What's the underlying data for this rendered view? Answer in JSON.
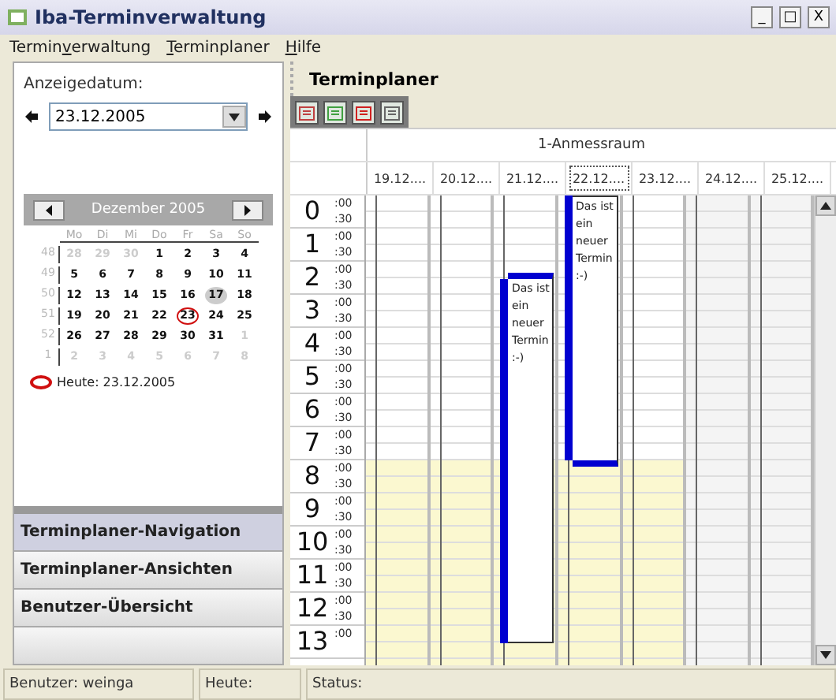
{
  "window": {
    "title": "Iba-Terminverwaltung",
    "controls": [
      "_",
      "□",
      "X"
    ]
  },
  "menu": [
    {
      "parts": [
        {
          "text": "Termin",
          "underlined": false
        },
        {
          "text": "v",
          "underlined": true
        },
        {
          "text": "erwaltung",
          "underlined": false
        }
      ]
    },
    {
      "parts": [
        {
          "text": "T",
          "underlined": true
        },
        {
          "text": "erminplaner",
          "underlined": false
        }
      ]
    },
    {
      "parts": [
        {
          "text": "H",
          "underlined": true
        },
        {
          "text": "ilfe",
          "underlined": false
        }
      ]
    }
  ],
  "date_selector": {
    "label": "Anzeigedatum:",
    "value": "23.12.2005"
  },
  "calendar": {
    "month": "Dezember 2005",
    "weekdays": [
      "Mo",
      "Di",
      "Mi",
      "Do",
      "Fr",
      "Sa",
      "So"
    ],
    "weeks": [
      {
        "number": "48",
        "days": [
          {
            "label": "28",
            "other_month": true,
            "today": false,
            "hover": false
          },
          {
            "label": "29",
            "other_month": true,
            "today": false,
            "hover": false
          },
          {
            "label": "30",
            "other_month": true,
            "today": false,
            "hover": false
          },
          {
            "label": "1",
            "other_month": false,
            "today": false,
            "hover": false
          },
          {
            "label": "2",
            "other_month": false,
            "today": false,
            "hover": false
          },
          {
            "label": "3",
            "other_month": false,
            "today": false,
            "hover": false
          },
          {
            "label": "4",
            "other_month": false,
            "today": false,
            "hover": false
          }
        ]
      },
      {
        "number": "49",
        "days": [
          {
            "label": "5",
            "other_month": false,
            "today": false,
            "hover": false
          },
          {
            "label": "6",
            "other_month": false,
            "today": false,
            "hover": false
          },
          {
            "label": "7",
            "other_month": false,
            "today": false,
            "hover": false
          },
          {
            "label": "8",
            "other_month": false,
            "today": false,
            "hover": false
          },
          {
            "label": "9",
            "other_month": false,
            "today": false,
            "hover": false
          },
          {
            "label": "10",
            "other_month": false,
            "today": false,
            "hover": false
          },
          {
            "label": "11",
            "other_month": false,
            "today": false,
            "hover": false
          }
        ]
      },
      {
        "number": "50",
        "days": [
          {
            "label": "12",
            "other_month": false,
            "today": false,
            "hover": false
          },
          {
            "label": "13",
            "other_month": false,
            "today": false,
            "hover": false
          },
          {
            "label": "14",
            "other_month": false,
            "today": false,
            "hover": false
          },
          {
            "label": "15",
            "other_month": false,
            "today": false,
            "hover": false
          },
          {
            "label": "16",
            "other_month": false,
            "today": false,
            "hover": false
          },
          {
            "label": "17",
            "other_month": false,
            "today": false,
            "hover": true
          },
          {
            "label": "18",
            "other_month": false,
            "today": false,
            "hover": false
          }
        ]
      },
      {
        "number": "51",
        "days": [
          {
            "label": "19",
            "other_month": false,
            "today": false,
            "hover": false
          },
          {
            "label": "20",
            "other_month": false,
            "today": false,
            "hover": false
          },
          {
            "label": "21",
            "other_month": false,
            "today": false,
            "hover": false
          },
          {
            "label": "22",
            "other_month": false,
            "today": false,
            "hover": false
          },
          {
            "label": "23",
            "other_month": false,
            "today": true,
            "hover": false
          },
          {
            "label": "24",
            "other_month": false,
            "today": false,
            "hover": false
          },
          {
            "label": "25",
            "other_month": false,
            "today": false,
            "hover": false
          }
        ]
      },
      {
        "number": "52",
        "days": [
          {
            "label": "26",
            "other_month": false,
            "today": false,
            "hover": false
          },
          {
            "label": "27",
            "other_month": false,
            "today": false,
            "hover": false
          },
          {
            "label": "28",
            "other_month": false,
            "today": false,
            "hover": false
          },
          {
            "label": "29",
            "other_month": false,
            "today": false,
            "hover": false
          },
          {
            "label": "30",
            "other_month": false,
            "today": false,
            "hover": false
          },
          {
            "label": "31",
            "other_month": false,
            "today": false,
            "hover": false
          },
          {
            "label": "1",
            "other_month": true,
            "today": false,
            "hover": false
          }
        ]
      },
      {
        "number": "1",
        "days": [
          {
            "label": "2",
            "other_month": true,
            "today": false,
            "hover": false
          },
          {
            "label": "3",
            "other_month": true,
            "today": false,
            "hover": false
          },
          {
            "label": "4",
            "other_month": true,
            "today": false,
            "hover": false
          },
          {
            "label": "5",
            "other_month": true,
            "today": false,
            "hover": false
          },
          {
            "label": "6",
            "other_month": true,
            "today": false,
            "hover": false
          },
          {
            "label": "7",
            "other_month": true,
            "today": false,
            "hover": false
          },
          {
            "label": "8",
            "other_month": true,
            "today": false,
            "hover": false
          }
        ]
      }
    ],
    "today_label": "Heute: 23.12.2005"
  },
  "nav_sections": [
    {
      "label": "Terminplaner-Navigation",
      "selected": true
    },
    {
      "label": "Terminplaner-Ansichten",
      "selected": false
    },
    {
      "label": "Benutzer-Übersicht",
      "selected": false
    }
  ],
  "planner": {
    "title": "Terminplaner",
    "room": "1-Anmessraum",
    "hours": [
      {
        "hour": "0",
        "marks": [
          ":00",
          ":30"
        ]
      },
      {
        "hour": "1",
        "marks": [
          ":00",
          ":30"
        ]
      },
      {
        "hour": "2",
        "marks": [
          ":00",
          ":30"
        ]
      },
      {
        "hour": "3",
        "marks": [
          ":00",
          ":30"
        ]
      },
      {
        "hour": "4",
        "marks": [
          ":00",
          ":30"
        ]
      },
      {
        "hour": "5",
        "marks": [
          ":00",
          ":30"
        ]
      },
      {
        "hour": "6",
        "marks": [
          ":00",
          ":30"
        ]
      },
      {
        "hour": "7",
        "marks": [
          ":00",
          ":30"
        ]
      },
      {
        "hour": "8",
        "marks": [
          ":00",
          ":30"
        ]
      },
      {
        "hour": "9",
        "marks": [
          ":00",
          ":30"
        ]
      },
      {
        "hour": "10",
        "marks": [
          ":00",
          ":30"
        ]
      },
      {
        "hour": "11",
        "marks": [
          ":00",
          ":30"
        ]
      },
      {
        "hour": "12",
        "marks": [
          ":00",
          ":30"
        ]
      },
      {
        "hour": "13",
        "marks": [
          ":00"
        ]
      }
    ],
    "days": [
      {
        "label": "19.12....",
        "kind": "workday",
        "focused": false
      },
      {
        "label": "20.12....",
        "kind": "workday",
        "focused": false
      },
      {
        "label": "21.12....",
        "kind": "workday",
        "focused": false,
        "appointment": {
          "text": "Das ist ein neuer Termin :-)",
          "booked": [
            false,
            false,
            false,
            false,
            false,
            true,
            true,
            true,
            true,
            true,
            true,
            true,
            true,
            true,
            true,
            true,
            true,
            true,
            true,
            true,
            true,
            true,
            true,
            true,
            true,
            true,
            true
          ]
        }
      },
      {
        "label": "22.12....",
        "kind": "workday",
        "focused": true,
        "appointment": {
          "text": "Das ist ein neuer Termin :-)",
          "booked": [
            true,
            true,
            true,
            true,
            true,
            true,
            true,
            true,
            true,
            true,
            true,
            true,
            true,
            true,
            true,
            true,
            false,
            false,
            false,
            false,
            false,
            false,
            false,
            false,
            false,
            false,
            false
          ]
        }
      },
      {
        "label": "23.12....",
        "kind": "workday",
        "focused": false
      },
      {
        "label": "24.12....",
        "kind": "weekend",
        "focused": false
      },
      {
        "label": "25.12....",
        "kind": "weekend",
        "focused": false
      }
    ]
  },
  "status_bar": [
    "Benutzer: weinga",
    "Heute:",
    "Status:"
  ]
}
